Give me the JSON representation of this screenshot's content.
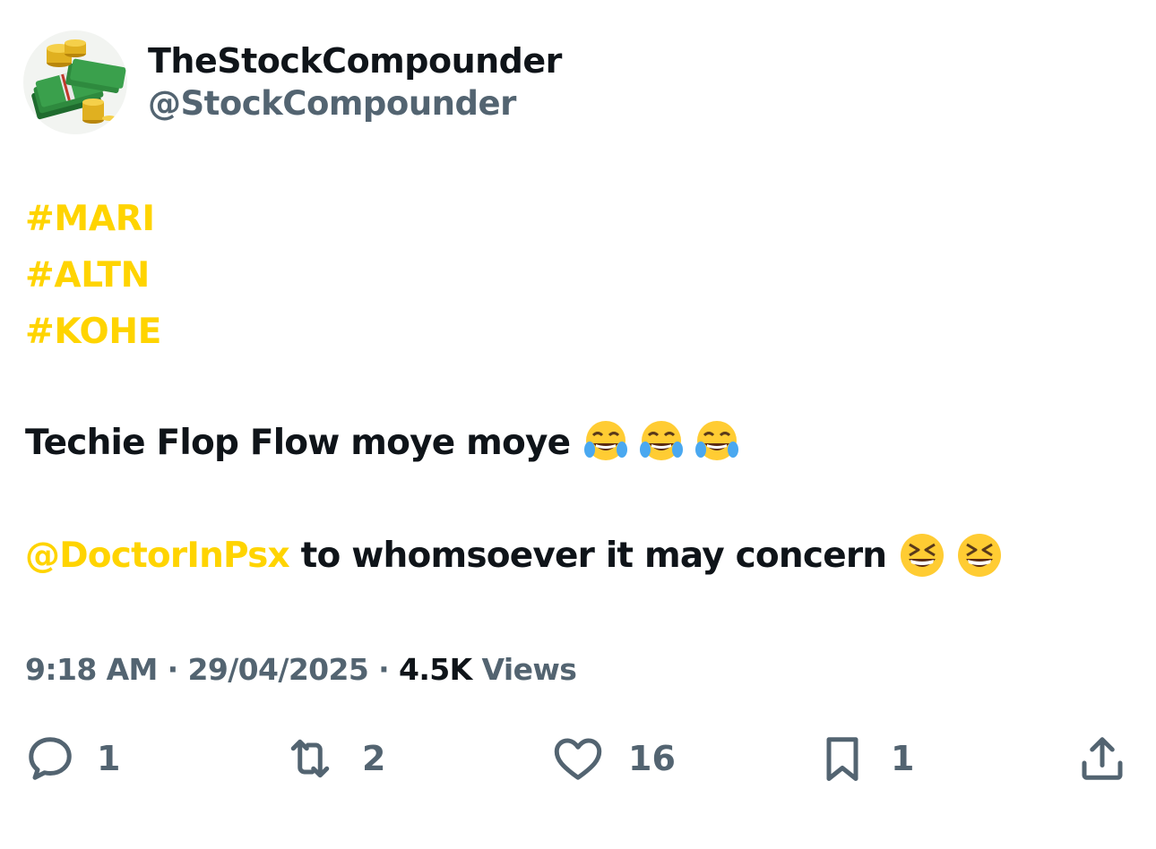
{
  "colors": {
    "accent": "#ffd400",
    "text_primary": "#0f1419",
    "text_secondary": "#536471",
    "background": "#ffffff"
  },
  "author": {
    "display_name": "TheStockCompounder",
    "handle": "@StockCompounder",
    "avatar_icon": "money-stack-avatar"
  },
  "tweet": {
    "hashtags": [
      "#MARI",
      "#ALTN",
      "#KOHE"
    ],
    "line1_text": "Techie Flop Flow moye moye",
    "line1_emojis": [
      "face-with-tears-of-joy",
      "face-with-tears-of-joy",
      "face-with-tears-of-joy"
    ],
    "mention": "@DoctorInPsx",
    "line2_text": " to whomsoever it may concern",
    "line2_emojis": [
      "grinning-squinting-face",
      "grinning-squinting-face"
    ]
  },
  "meta": {
    "time": "9:18 AM",
    "sep1": " · ",
    "date": "29/04/2025",
    "sep2": " · ",
    "views_count": "4.5K",
    "views_label": " Views"
  },
  "actions": {
    "reply": {
      "icon": "reply-icon",
      "count": "1"
    },
    "retweet": {
      "icon": "retweet-icon",
      "count": "2"
    },
    "like": {
      "icon": "heart-icon",
      "count": "16"
    },
    "bookmark": {
      "icon": "bookmark-icon",
      "count": "1"
    },
    "share": {
      "icon": "share-icon"
    }
  }
}
